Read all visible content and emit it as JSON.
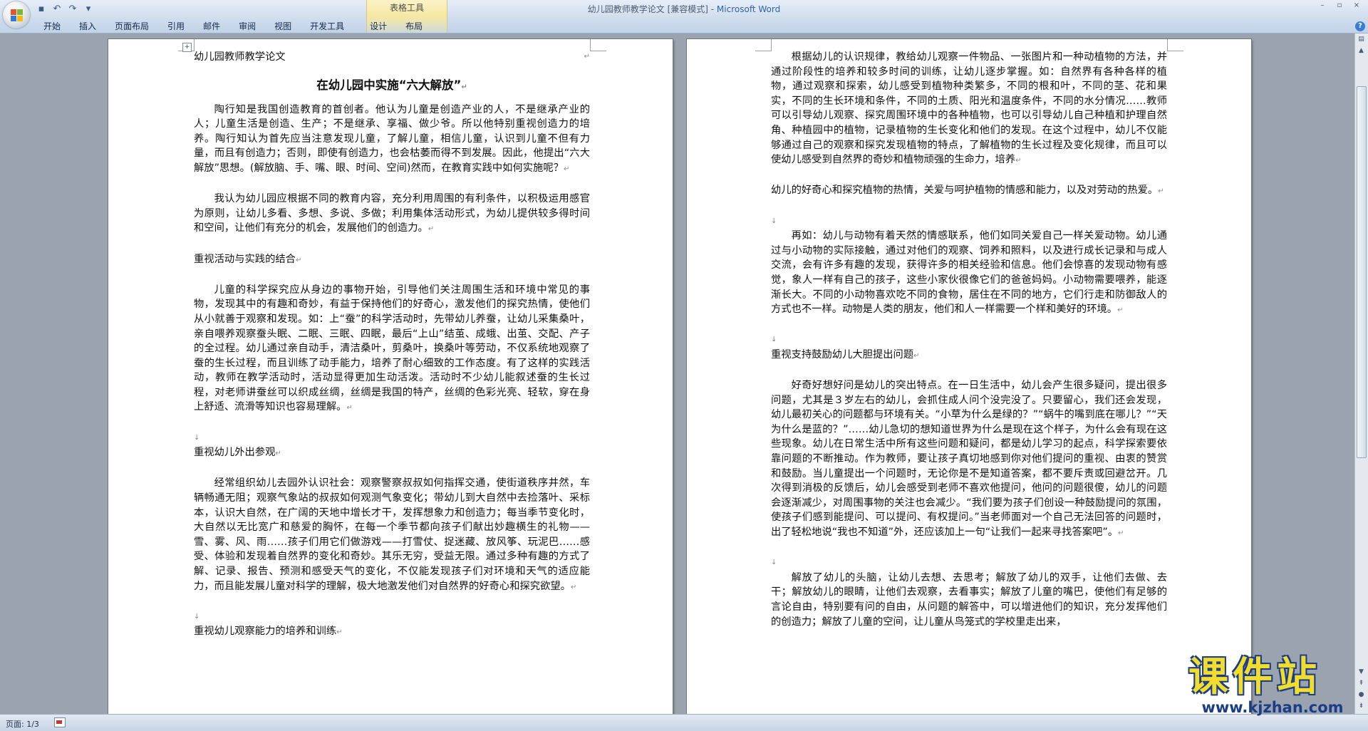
{
  "window": {
    "title_doc": "幼儿园教师教学论文 [兼容模式] - ",
    "title_app": "Microsoft Word",
    "context_group": "表格工具"
  },
  "qat": {
    "save": "▪",
    "undo": "↶",
    "redo": "↷",
    "more": "▾"
  },
  "tabs": [
    "开始",
    "插入",
    "页面布局",
    "引用",
    "邮件",
    "审阅",
    "视图",
    "开发工具",
    "设计",
    "布局"
  ],
  "status": {
    "page": "页面: 1/3"
  },
  "watermark": {
    "cn": "课件站",
    "url": "www.kjzhan.com"
  },
  "colors": {
    "ribbon": "#cfdcec",
    "workspace": "#9ba3ae",
    "brand": "#2f62a8",
    "watermark_fill": "#f2dd2d",
    "watermark_outline": "#1a3d8a"
  },
  "icons": [
    "office-button-icon",
    "save-icon",
    "undo-icon",
    "redo-icon",
    "customize-qat-icon",
    "help-icon",
    "table-move-handle-icon",
    "minimize-icon",
    "maximize-icon",
    "close-icon"
  ],
  "left_page": {
    "header": "幼儿园教师教学论文",
    "title": "在幼儿园中实施“六大解放”",
    "p1": "陶行知是我国创造教育的首创者。他认为儿童是创造产业的人，不是继承产业的人；儿童生活是创造、生产；不是继承、享福、做少爷。所以他特别重视创造力的培养。陶行知认为首先应当注意发现儿童，了解儿童，相信儿童，认识到儿童不但有力量，而且有创造力；否则，即使有创造力，也会枯萎而得不到发展。因此，他提出“六大解放”思想。(解放脑、手、嘴、眼、时间、空间)然而，在教育实践中如何实施呢？",
    "p2": "我认为幼儿园应根据不同的教育内容，充分利用周围的有利条件，以积极运用感官为原则，让幼儿多看、多想、多说、多做；利用集体活动形式，为幼儿提供较多得时间和空间，让他们有充分的机会，发展他们的创造力。",
    "h1": "重视活动与实践的结合",
    "p3": "儿童的科学探究应从身边的事物开始，引导他们关注周围生活和环境中常见的事物，发现其中的有趣和奇妙，有益于保持他们的好奇心，激发他们的探究热情，使他们从小就善于观察和发现。如：上“蚕”的科学活动时，先带幼儿养蚕，让幼儿采集桑叶，亲自喂养观察蚕头眠、二眠、三眠、四眠，最后“上山”结茧、成蛾、出茧、交配、产子的全过程。幼儿通过亲自动手，清洁桑叶，剪桑叶，换桑叶等劳动，不仅系统地观察了蚕的生长过程，而且训练了动手能力，培养了耐心细致的工作态度。有了这样的实践活动，教师在教学活动时，活动显得更加生动活泼。活动时不少幼儿能叙述蚕的生长过程，对老师讲蚕丝可以织成丝绸，丝绸是我国的特产，丝绸的色彩光亮、轻软，穿在身上舒适、流滑等知识也容易理解。",
    "h2": "重视幼儿外出参观",
    "p4": "经常组织幼儿去园外认识社会：观察警察叔叔如何指挥交通，使街道秩序井然，车辆畅通无阻；观察气象站的叔叔如何观测气象变化；带幼儿到大自然中去捡落叶、采标本，认识大自然，在广阔的天地中增长才干，发挥想象力和创造力；每当季节变化时，大自然以无比宽广和慈爱的胸怀，在每一个季节都向孩子们献出妙趣横生的礼物——雪、雾、风、雨……孩子们用它们做游戏——打雪仗、捉迷藏、放风筝、玩泥巴……感受、体验和发现着自然界的变化和奇妙。其乐无穷，受益无限。通过多种有趣的方式了解、记录、报告、预测和感受天气的变化，不仅能发现孩子们对环境和天气的适应能力，而且能发展儿童对科学的理解，极大地激发他们对自然界的好奇心和探究欲望。",
    "h3": "重视幼儿观察能力的培养和训练"
  },
  "right_page": {
    "p1": "根据幼儿的认识规律，教给幼儿观察一件物品、一张图片和一种动植物的方法，并通过阶段性的培养和较多时间的训练，让幼儿逐步掌握。如：自然界有各种各样的植物，通过观察和探索，幼儿感受到植物种类繁多，不同的根和叶，不同的茎、花和果实，不同的生长环境和条件，不同的土质、阳光和温度条件，不同的水分情况……教师可以引导幼儿观察、探究周围环境中的各种植物，也可以引导幼儿自己种植和护理自然角、种植园中的植物，记录植物的生长变化和他们的发现。在这个过程中，幼儿不仅能够通过自己的观察和探究发现植物的特点，了解植物的生长过程及变化规律，而且可以使幼儿感受到自然界的奇妙和植物顽强的生命力，培养",
    "p2": "幼儿的好奇心和探究植物的热情，关爱与呵护植物的情感和能力，以及对劳动的热爱。",
    "p3": "再如：幼儿与动物有着天然的情感联系，他们如同关爱自己一样关爱动物。幼儿通过与小动物的实际接触，通过对他们的观察、饲养和照料，以及进行成长记录和与成人交流，会有许多有趣的发现，获得许多的相关经验和信息。他们会惊喜的发现动物有感觉，象人一样有自己的孩子，这些小家伙很像它们的爸爸妈妈。小动物需要喂养，能逐渐长大。不同的小动物喜欢吃不同的食物，居住在不同的地方，它们行走和防御敌人的方式也不一样。动物是人类的朋友，他们和人一样需要一个样和美好的环境。",
    "h1": "重视支持鼓励幼儿大胆提出问题",
    "p4": "好奇好想好问是幼儿的突出特点。在一日生活中，幼儿会产生很多疑问，提出很多问题，尤其是３岁左右的幼儿，会抓住成人问个没完没了。只要留心，我们还会发现，幼儿最初关心的问题都与环境有关。“小草为什么是绿的？”“蜗牛的嘴到底在哪儿？”“天为什么是蓝的？”……幼儿急切的想知道世界为什么是现在这个样子，为什么会有现在这些现象。幼儿在日常生活中所有这些问题和疑问，都是幼儿学习的起点，科学探索要依靠问题的不断推动。作为教师，要让孩子真切地感到你对他们提问的重视、由衷的赞赏和鼓励。当儿童提出一个问题时，无论你是不是知道答案，都不要斥责或回避岔开。几次得到消极的反馈后，幼儿会感受到老师不喜欢他提问，他问的问题很傻，幼儿的问题会逐渐减少，对周围事物的关注也会减少。“我们要为孩子们创设一种鼓励提问的氛围，使孩子们感到能提问、可以提问、有权提问。”当老师面对一个自己无法回答的问题时，出了轻松地说“我也不知道”外，还应该加上一句“让我们一起来寻找答案吧”。",
    "p5": "解放了幼儿的头脑，让幼儿去想、去思考；解放了幼儿的双手，让他们去做、去干；解放幼儿的眼睛，让他们去观察，去看事实；解放了儿童的嘴巴，使他们有足够的言论自由，特别要有问的自由，从问题的解答中，可以增进他们的知识，充分发挥他们的创造力；解放了儿童的空间，让儿童从鸟笼式的学校里走出来，"
  }
}
